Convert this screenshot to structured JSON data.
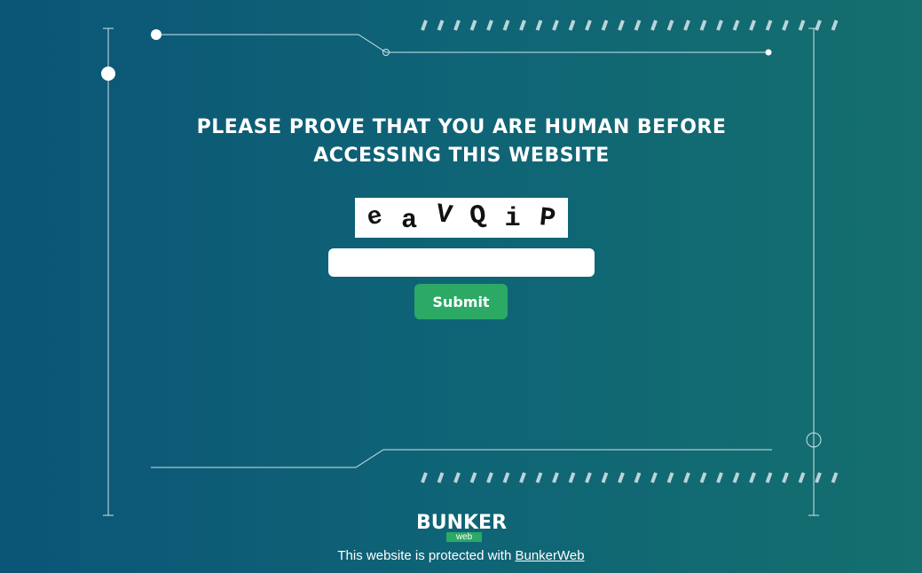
{
  "heading": "PLEASE PROVE THAT YOU ARE HUMAN BEFORE ACCESSING THIS WEBSITE",
  "captcha": {
    "characters": [
      "e",
      "a",
      "V",
      "Q",
      "i",
      "P"
    ]
  },
  "form": {
    "input_value": "",
    "submit_label": "Submit"
  },
  "logo": {
    "title": "BUNKER",
    "subtitle": "web"
  },
  "footer": {
    "text": "This website is protected with",
    "link_label": "BunkerWeb"
  },
  "colors": {
    "background_start": "#0b5577",
    "background_end": "#146f6e",
    "accent": "#2ba965"
  }
}
